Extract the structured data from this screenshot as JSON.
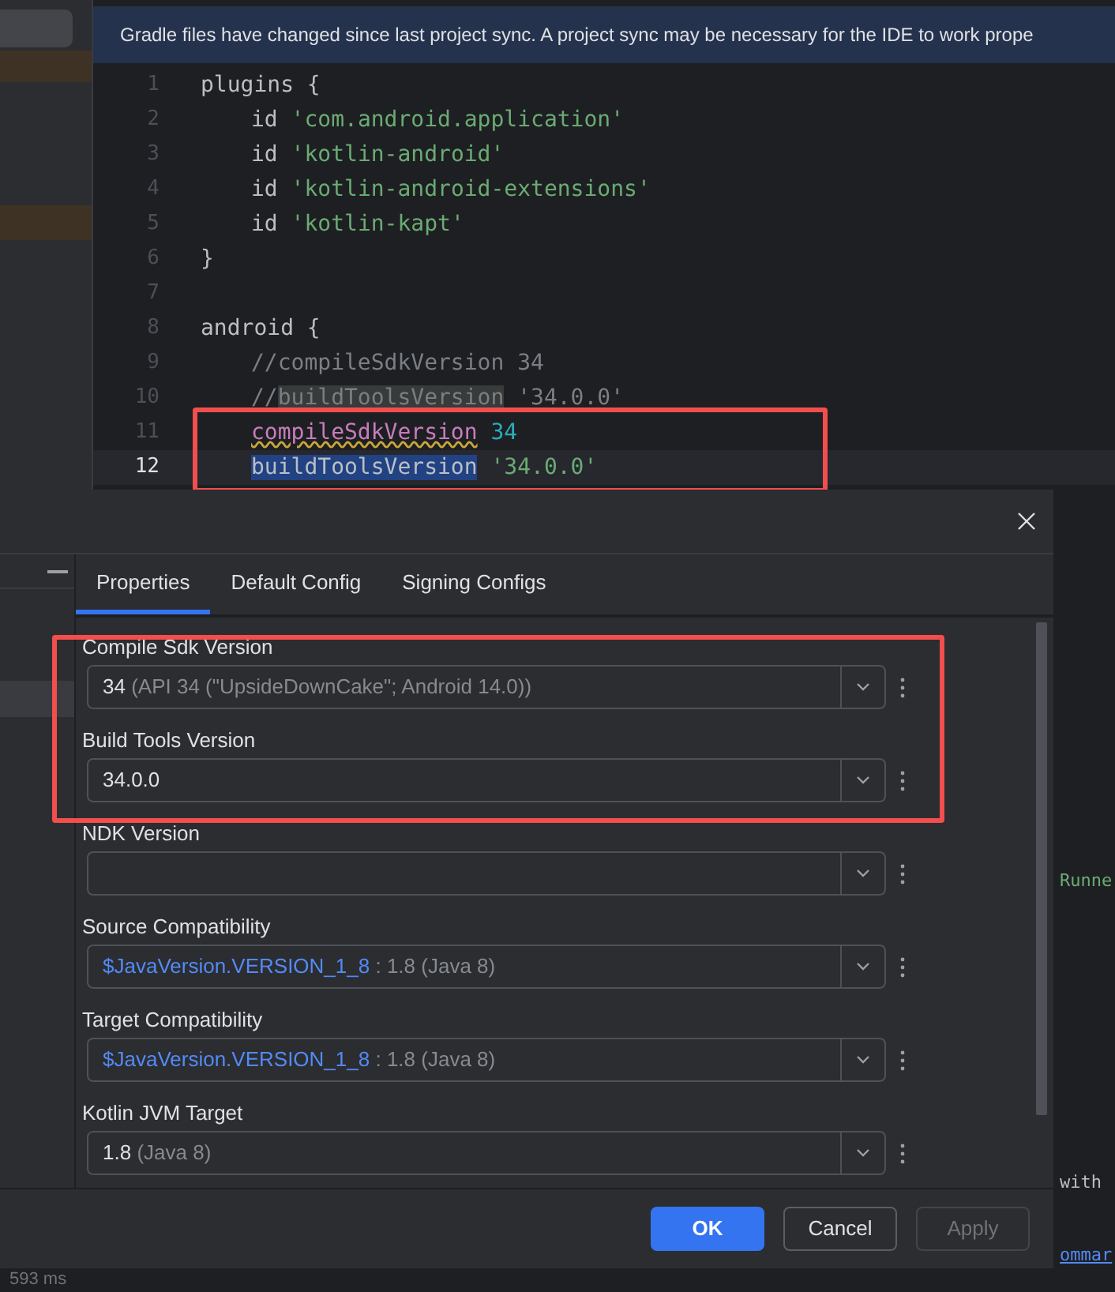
{
  "sidebar_rows": [
    {
      "selected": true
    },
    {
      "selected": false
    },
    {
      "selected": false
    }
  ],
  "banner": {
    "text": "Gradle files have changed since last project sync. A project sync may be necessary for the IDE to work prope"
  },
  "editor": {
    "lines": [
      {
        "number": "1",
        "current": false,
        "tokens": [
          {
            "text": "plugins {",
            "kind": "plain"
          }
        ],
        "children": [
          {
            "number": "2",
            "current": false,
            "tokens": [
              {
                "text": "id ",
                "kind": "plain"
              },
              {
                "text": "'com.android.application'",
                "kind": "string"
              }
            ]
          },
          {
            "number": "3",
            "current": false,
            "tokens": [
              {
                "text": "id ",
                "kind": "plain"
              },
              {
                "text": "'kotlin-android'",
                "kind": "string"
              }
            ]
          },
          {
            "number": "4",
            "current": false,
            "tokens": [
              {
                "text": "id ",
                "kind": "plain"
              },
              {
                "text": "'kotlin-android-extensions'",
                "kind": "string"
              }
            ]
          },
          {
            "number": "5",
            "current": false,
            "tokens": [
              {
                "text": "id ",
                "kind": "plain"
              },
              {
                "text": "'kotlin-kapt'",
                "kind": "string"
              }
            ]
          }
        ]
      },
      {
        "number": "6",
        "current": false,
        "tokens": [
          {
            "text": "}",
            "kind": "plain"
          }
        ]
      },
      {
        "number": "7",
        "current": false
      },
      {
        "number": "8",
        "current": false,
        "tokens": [
          {
            "text": "android {",
            "kind": "plain"
          }
        ],
        "children": [
          {
            "number": "9",
            "current": false,
            "tokens": [
              {
                "text": "//compileSdkVersion 34",
                "kind": "comment"
              }
            ]
          },
          {
            "number": "10",
            "current": false,
            "tokens": [
              {
                "text": "//",
                "kind": "comment"
              },
              {
                "text": "buildToolsVersion",
                "kind": "comment",
                "usage_highlight": true
              },
              {
                "text": " '34.0.0'",
                "kind": "comment"
              }
            ]
          },
          {
            "number": "11",
            "current": false,
            "tokens": [
              {
                "text": "compileSdkVersion",
                "kind": "property",
                "warning": true
              },
              {
                "text": " 34",
                "kind": "number"
              }
            ]
          },
          {
            "number": "12",
            "current": true,
            "tokens": [
              {
                "text": "buildToolsVersion",
                "kind": "plain",
                "selected": true
              },
              {
                "text": " '34.0.0'",
                "kind": "string"
              }
            ]
          }
        ]
      }
    ]
  },
  "background_fragments": [
    {
      "text": "Runne",
      "kind": "string"
    },
    {
      "text": "with",
      "kind": "plain"
    },
    {
      "text": "ommar",
      "kind": "link"
    }
  ],
  "status_text": "593 ms",
  "dialog": {
    "tabs": [
      {
        "label": "Properties",
        "selected": true
      },
      {
        "label": "Default Config",
        "selected": false
      },
      {
        "label": "Signing Configs",
        "selected": false
      }
    ],
    "fields": [
      {
        "label": "Compile Sdk Version",
        "value": "34",
        "hint": "(API 34 (\"UpsideDownCake\"; Android 14.0))",
        "kind": "plain"
      },
      {
        "label": "Build Tools Version",
        "value": "34.0.0",
        "kind": "plain"
      },
      {
        "label": "NDK Version"
      },
      {
        "label": "Source Compatibility",
        "value": "$JavaVersion.VERSION_1_8",
        "hint": ": 1.8 (Java 8)",
        "kind": "reference"
      },
      {
        "label": "Target Compatibility",
        "value": "$JavaVersion.VERSION_1_8",
        "hint": ": 1.8 (Java 8)",
        "kind": "reference"
      },
      {
        "label": "Kotlin JVM Target",
        "value": "1.8",
        "hint": "(Java 8)",
        "kind": "plain"
      }
    ],
    "buttons": [
      {
        "label": "OK",
        "kind": "primary",
        "disabled": false
      },
      {
        "label": "Cancel",
        "kind": "secondary",
        "disabled": false
      },
      {
        "label": "Apply",
        "kind": "secondary",
        "disabled": true
      }
    ]
  }
}
